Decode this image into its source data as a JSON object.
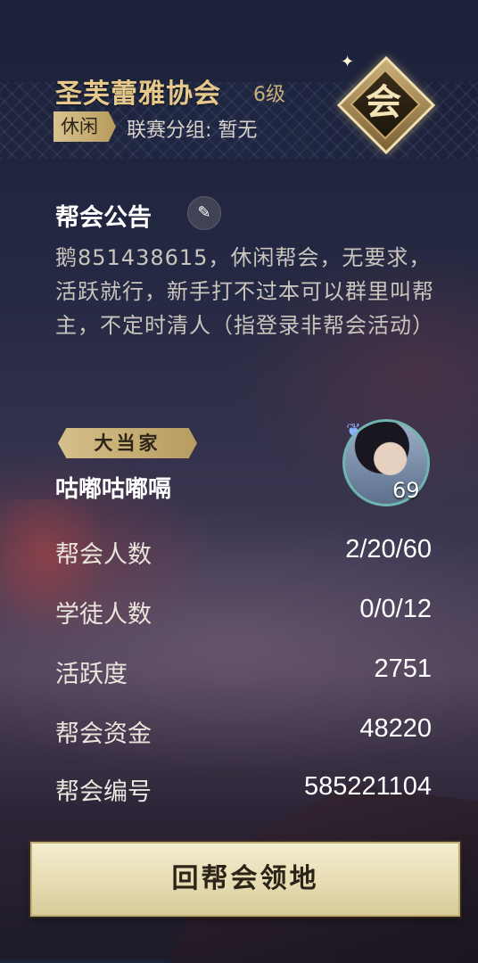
{
  "header": {
    "guild_name": "圣芙蕾雅协会",
    "level": "6级",
    "mode_tag": "休闲",
    "league_group": "联赛分组: 暂无",
    "emblem_glyph": "会"
  },
  "notice": {
    "title": "帮会公告",
    "edit_icon": "pencil-icon",
    "body": "鹅851438615，休闲帮会，无要求，活跃就行，新手打不过本可以群里叫帮主，不定时清人（指登录非帮会活动）"
  },
  "leader": {
    "tag": "大当家",
    "name": "咕嘟咕嘟嗝",
    "avatar_level": "69"
  },
  "stats": [
    {
      "label": "帮会人数",
      "value": "2/20/60"
    },
    {
      "label": "学徒人数",
      "value": "0/0/12"
    },
    {
      "label": "活跃度",
      "value": "2751"
    },
    {
      "label": "帮会资金",
      "value": "48220"
    },
    {
      "label": "帮会编号",
      "value": "585221104"
    }
  ],
  "actions": {
    "return_label": "回帮会领地"
  },
  "colors": {
    "gold": "#e6c98a",
    "button": "#e6dcb2"
  }
}
